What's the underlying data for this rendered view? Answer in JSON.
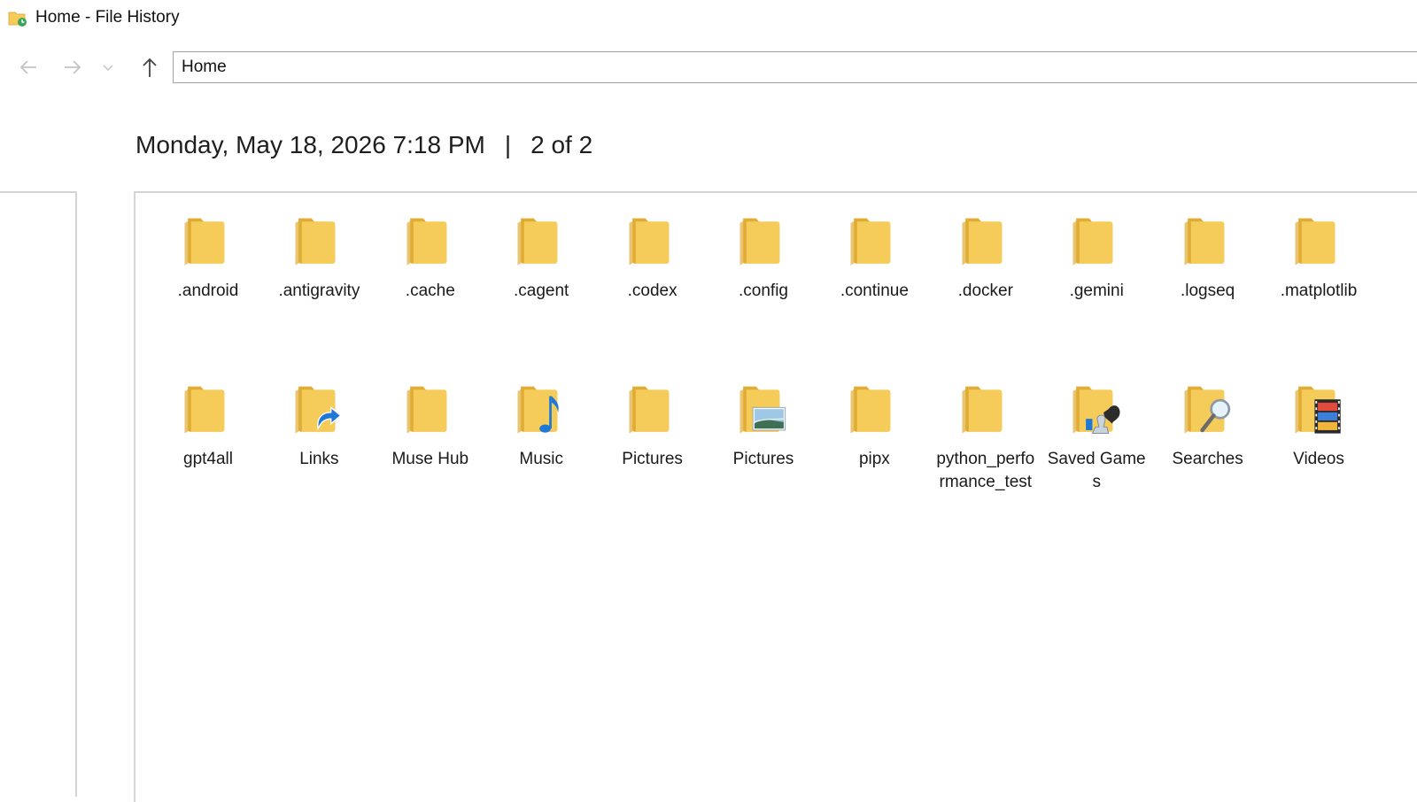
{
  "window": {
    "title": "Home - File History",
    "app_icon": "file-history-icon"
  },
  "nav": {
    "back_icon": "arrow-left-icon",
    "forward_icon": "arrow-right-icon",
    "recent_icon": "chevron-down-icon",
    "up_icon": "arrow-up-icon",
    "address": "Home"
  },
  "snapshot": {
    "datetime": "Monday, May 18, 2026 7:18 PM",
    "separator": "|",
    "position": "2 of 2"
  },
  "colors": {
    "folder": "#f5cc5a",
    "folder_dark": "#e0ac35",
    "accent_blue": "#1e78d7"
  },
  "items": [
    {
      "label": ".android",
      "icon": "folder-icon"
    },
    {
      "label": ".antigravity",
      "icon": "folder-icon"
    },
    {
      "label": ".cache",
      "icon": "folder-icon"
    },
    {
      "label": ".cagent",
      "icon": "folder-icon"
    },
    {
      "label": ".codex",
      "icon": "folder-icon"
    },
    {
      "label": ".config",
      "icon": "folder-icon"
    },
    {
      "label": ".continue",
      "icon": "folder-icon"
    },
    {
      "label": ".docker",
      "icon": "folder-icon"
    },
    {
      "label": ".gemini",
      "icon": "folder-icon"
    },
    {
      "label": ".logseq",
      "icon": "folder-icon"
    },
    {
      "label": ".matplotlib",
      "icon": "folder-icon"
    },
    {
      "label": "gpt4all",
      "icon": "folder-icon"
    },
    {
      "label": "Links",
      "icon": "links-folder-icon"
    },
    {
      "label": "Muse Hub",
      "icon": "folder-icon"
    },
    {
      "label": "Music",
      "icon": "music-folder-icon"
    },
    {
      "label": "Pictures",
      "icon": "folder-icon"
    },
    {
      "label": "Pictures",
      "icon": "pictures-folder-icon"
    },
    {
      "label": "pipx",
      "icon": "folder-icon"
    },
    {
      "label": "python_performance_test",
      "icon": "folder-icon"
    },
    {
      "label": "Saved Games",
      "icon": "saved-games-folder-icon"
    },
    {
      "label": "Searches",
      "icon": "searches-folder-icon"
    },
    {
      "label": "Videos",
      "icon": "videos-folder-icon"
    }
  ]
}
